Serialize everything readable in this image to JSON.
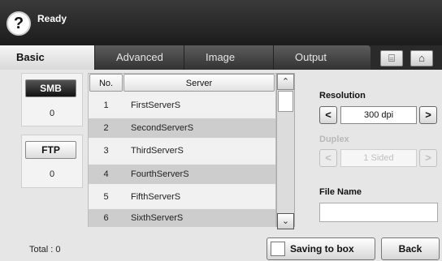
{
  "status": {
    "text": "Ready",
    "help_icon_glyph": "?"
  },
  "tabs": [
    {
      "label": "Basic",
      "active": true
    },
    {
      "label": "Advanced",
      "active": false
    },
    {
      "label": "Image",
      "active": false
    },
    {
      "label": "Output",
      "active": false
    }
  ],
  "tab_icons": {
    "address_book": "⌸",
    "home": "⌂"
  },
  "protocols": {
    "smb": {
      "label": "SMB",
      "count": "0",
      "selected": true
    },
    "ftp": {
      "label": "FTP",
      "count": "0",
      "selected": false
    }
  },
  "table": {
    "headers": {
      "no": "No.",
      "server": "Server"
    },
    "rows": [
      {
        "no": "1",
        "server": "FirstServerS"
      },
      {
        "no": "2",
        "server": "SecondServerS"
      },
      {
        "no": "3",
        "server": "ThirdServerS"
      },
      {
        "no": "4",
        "server": "FourthServerS"
      },
      {
        "no": "5",
        "server": "FifthServerS"
      },
      {
        "no": "6",
        "server": "SixthServerS"
      }
    ]
  },
  "scrollbar": {
    "up_glyph": "⌃",
    "down_glyph": "⌄"
  },
  "settings": {
    "resolution": {
      "label": "Resolution",
      "value": "300 dpi",
      "prev": "<",
      "next": ">"
    },
    "duplex": {
      "label": "Duplex",
      "value": "1 Sided",
      "prev": "<",
      "next": ">",
      "enabled": false
    },
    "file_name": {
      "label": "File Name",
      "value": ""
    }
  },
  "footer": {
    "total": "Total : 0",
    "saving_to_box": "Saving to box",
    "back": "Back"
  }
}
